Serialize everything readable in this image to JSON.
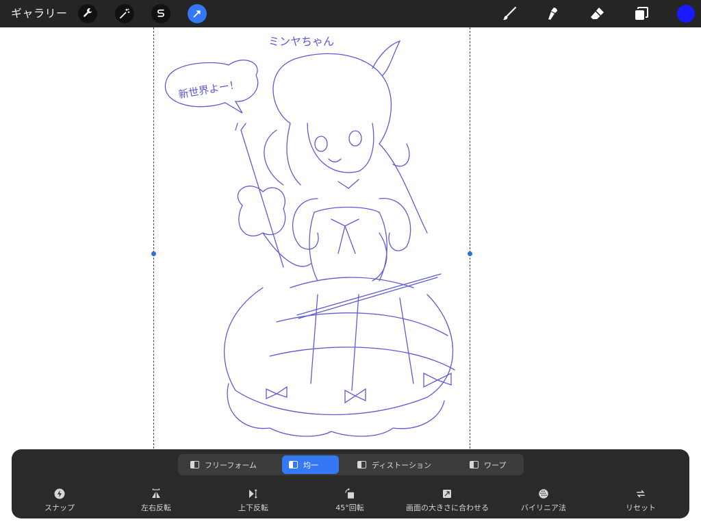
{
  "toolbar": {
    "gallery_label": "ギャラリー",
    "icons": [
      "wrench-icon",
      "magic-wand-icon",
      "selection-s-icon",
      "transform-arrow-icon",
      "brush-icon",
      "smudge-icon",
      "eraser-icon",
      "layers-icon"
    ],
    "active_color": "#1a1aff",
    "accent": "#3478f6"
  },
  "canvas": {
    "sketch_texts": [
      "ミンヤちゃん",
      "新世界よー！"
    ]
  },
  "transform_modes": {
    "items": [
      {
        "label": "フリーフォーム",
        "active": false
      },
      {
        "label": "均一",
        "active": true
      },
      {
        "label": "ディストーション",
        "active": false
      },
      {
        "label": "ワープ",
        "active": false
      }
    ]
  },
  "transform_tools": [
    {
      "label": "スナップ",
      "icon": "snap-bolt-icon"
    },
    {
      "label": "左右反転",
      "icon": "flip-horizontal-icon"
    },
    {
      "label": "上下反転",
      "icon": "flip-vertical-icon"
    },
    {
      "label": "45°回転",
      "icon": "rotate-45-icon"
    },
    {
      "label": "画面の大きさに合わせる",
      "icon": "fit-to-screen-icon"
    },
    {
      "label": "バイリニア法",
      "icon": "bilinear-icon"
    },
    {
      "label": "リセット",
      "icon": "reset-icon"
    }
  ]
}
